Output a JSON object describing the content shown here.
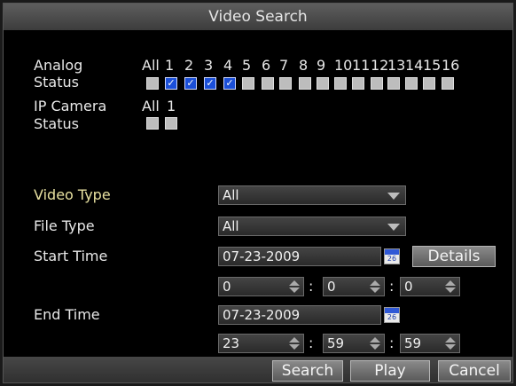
{
  "title": "Video Search",
  "analog": {
    "label1": "Analog",
    "label2": "Status",
    "all_label": "All",
    "channels": [
      "1",
      "2",
      "3",
      "4",
      "5",
      "6",
      "7",
      "8",
      "9",
      "10",
      "11",
      "12",
      "13",
      "14",
      "15",
      "16"
    ],
    "checked": [
      true,
      true,
      true,
      true,
      false,
      false,
      false,
      false,
      false,
      false,
      false,
      false,
      false,
      false,
      false,
      false
    ]
  },
  "ipcam": {
    "label1": "IP Camera",
    "label2": "Status",
    "all_label": "All",
    "channel": "1"
  },
  "video_type": {
    "label": "Video Type",
    "value": "All"
  },
  "file_type": {
    "label": "File Type",
    "value": "All"
  },
  "start_time": {
    "label": "Start Time",
    "date": "07-23-2009",
    "calendar_day": "26",
    "hour": "0",
    "minute": "0",
    "second": "0"
  },
  "end_time": {
    "label": "End Time",
    "date": "07-23-2009",
    "calendar_day": "26",
    "hour": "23",
    "minute": "59",
    "second": "59"
  },
  "buttons": {
    "details": "Details",
    "search": "Search",
    "play": "Play",
    "cancel": "Cancel"
  },
  "colors": {
    "background": "#000000",
    "checked": "#1b4fd8",
    "yellow_label": "#e7e0a0"
  }
}
